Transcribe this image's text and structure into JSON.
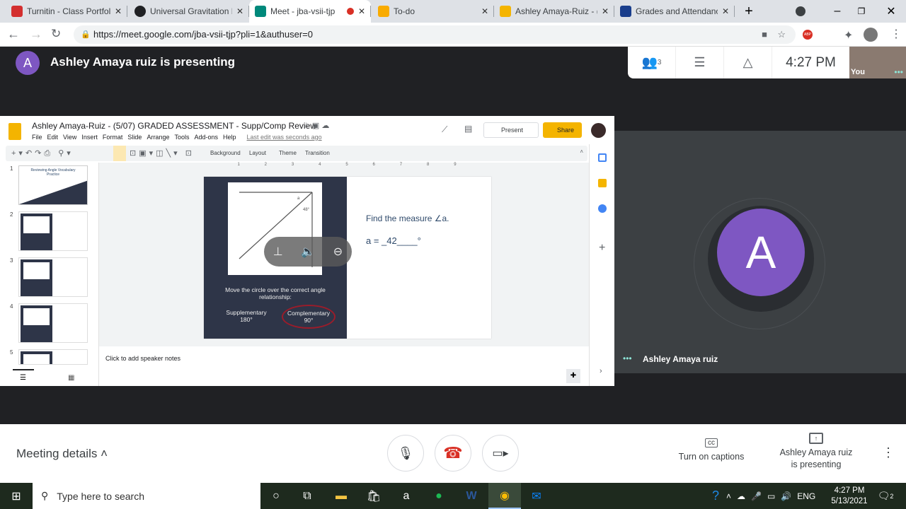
{
  "browser": {
    "tabs": [
      {
        "label": "Turnitin - Class Portfolio",
        "color": "#d32f2f"
      },
      {
        "label": "Universal Gravitation L",
        "color": "#202124"
      },
      {
        "label": "Meet - jba-vsii-tjp",
        "color": "#00897b"
      },
      {
        "label": "To-do",
        "color": "#f9ab00"
      },
      {
        "label": "Ashley Amaya-Ruiz - (",
        "color": "#f4b400"
      },
      {
        "label": "Grades and Attendance",
        "color": "#1a3e8c"
      }
    ],
    "url": "https://meet.google.com/jba-vsii-tjp?pli=1&authuser=0",
    "abp": "ABP"
  },
  "meet": {
    "presenter_initial": "A",
    "presenting_title": "Ashley Amaya ruiz is presenting",
    "participants_count": "3",
    "time": "4:27 PM",
    "self_label": "You",
    "tile_name": "Ashley Amaya ruiz",
    "tile_initial": "A",
    "meeting_details": "Meeting details",
    "captions": "Turn on captions",
    "presenting_line1": "Ashley Amaya ruiz",
    "presenting_line2": "is presenting"
  },
  "slides": {
    "title": "Ashley Amaya-Ruiz - (5/07) GRADED ASSESSMENT - Supp/Comp Review",
    "menu": [
      "File",
      "Edit",
      "View",
      "Insert",
      "Format",
      "Slide",
      "Arrange",
      "Tools",
      "Add-ons",
      "Help"
    ],
    "last_edit": "Last edit was seconds ago",
    "present": "Present",
    "share": "Share",
    "toolbar": [
      "Background",
      "Layout",
      "Theme",
      "Transition"
    ],
    "ruler": [
      "1",
      "2",
      "3",
      "4",
      "5",
      "6",
      "7",
      "8",
      "9"
    ],
    "thumb_numbers": [
      "1",
      "2",
      "3",
      "4",
      "5"
    ],
    "thumb1_title": "Reviewing Angle Vocabulary Practice",
    "speaker_notes": "Click to add speaker notes",
    "slide": {
      "angle_a": "a",
      "angle_48": "48°",
      "instruction": "Move the circle over the correct angle relationship:",
      "supp": "Supplementary",
      "supp_deg": "180°",
      "comp": "Complementary",
      "comp_deg": "90°",
      "question": "Find the measure ∠a.",
      "answer": "a = _42____°"
    }
  },
  "taskbar": {
    "search": "Type here to search",
    "lang": "ENG",
    "time": "4:27 PM",
    "date": "5/13/2021",
    "notif": "2"
  }
}
